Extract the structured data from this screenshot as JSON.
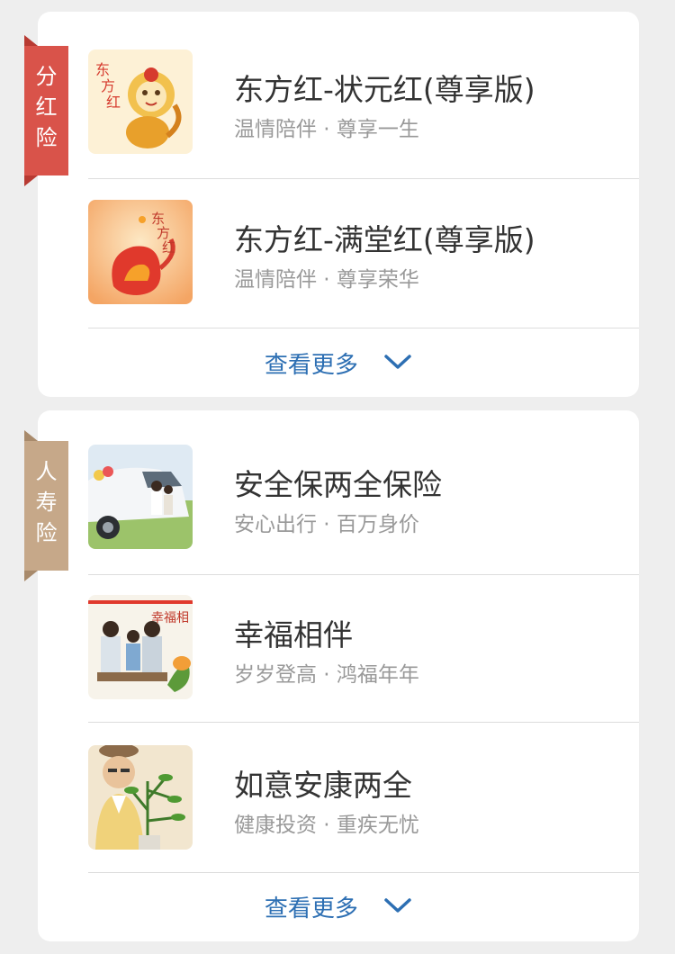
{
  "sections": [
    {
      "tag": "分红险",
      "tag_chars": [
        "分",
        "红",
        "险"
      ],
      "tag_color": "#d9534a",
      "items": [
        {
          "title": "东方红-状元红(尊享版)",
          "subtitle": "温情陪伴 · 尊享一生",
          "image": "monkey-gold-illustration"
        },
        {
          "title": "东方红-满堂红(尊享版)",
          "subtitle": "温情陪伴 · 尊享荣华",
          "image": "monkey-red-illustration"
        }
      ],
      "more_label": "查看更多"
    },
    {
      "tag": "人寿险",
      "tag_chars": [
        "人",
        "寿",
        "险"
      ],
      "tag_color": "#c6a889",
      "items": [
        {
          "title": "安全保两全保险",
          "subtitle": "安心出行 · 百万身价",
          "image": "family-car-photo"
        },
        {
          "title": "幸福相伴",
          "subtitle": "岁岁登高 · 鸿福年年",
          "image": "happy-family-photo"
        },
        {
          "title": "如意安康两全",
          "subtitle": "健康投资 · 重疾无忧",
          "image": "elderly-man-plant-photo"
        }
      ],
      "more_label": "查看更多"
    }
  ],
  "colors": {
    "background": "#eeeeee",
    "card": "#ffffff",
    "title": "#333333",
    "subtitle": "#999999",
    "link": "#2d6fb3"
  },
  "icons": {
    "more_chevron": "chevron-down-icon"
  }
}
